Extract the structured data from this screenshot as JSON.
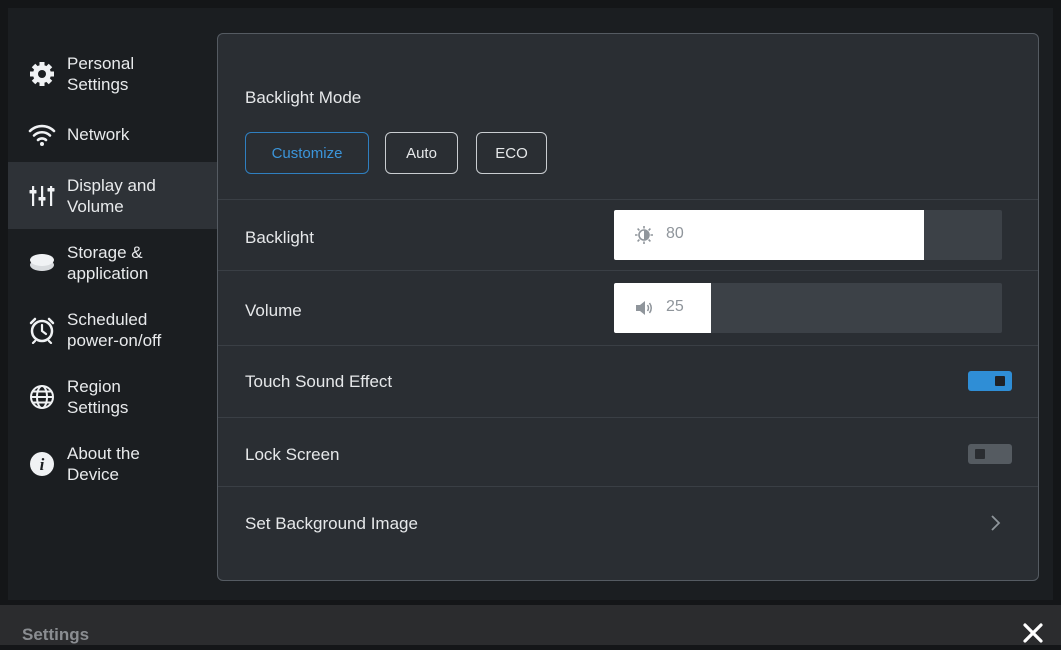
{
  "sidebar": {
    "items": [
      {
        "label_line1": "Personal",
        "label_line2": "Settings",
        "icon": "gear-icon"
      },
      {
        "label_line1": "Network",
        "icon": "wifi-icon"
      },
      {
        "label_line1": "Display and",
        "label_line2": "Volume",
        "icon": "sliders-icon",
        "active": true
      },
      {
        "label_line1": "Storage &",
        "label_line2": "application",
        "icon": "storage-icon"
      },
      {
        "label_line1": "Scheduled",
        "label_line2": "power-on/off",
        "icon": "alarm-clock-icon"
      },
      {
        "label_line1": "Region",
        "label_line2": "Settings",
        "icon": "globe-icon"
      },
      {
        "label_line1": "About the",
        "label_line2": "Device",
        "icon": "info-icon"
      }
    ]
  },
  "panel": {
    "backlight_mode": {
      "title": "Backlight Mode",
      "options": [
        "Customize",
        "Auto",
        "ECO"
      ],
      "selected": "Customize"
    },
    "backlight": {
      "label": "Backlight",
      "value": "80",
      "level": 0.8,
      "icon": "brightness-icon"
    },
    "volume": {
      "label": "Volume",
      "value": "25",
      "level": 0.25,
      "icon": "speaker-icon"
    },
    "touch_sound": {
      "label": "Touch Sound Effect",
      "enabled": true
    },
    "lock_screen": {
      "label": "Lock Screen",
      "enabled": false
    },
    "background_image": {
      "label": "Set Background Image",
      "icon": "chevron-right-icon"
    }
  },
  "bottom_bar": {
    "title": "Settings",
    "close_icon": "close-icon"
  },
  "colors": {
    "accent": "#2f8ed6",
    "panel_bg": "#2a2e33",
    "sidebar_active_bg": "#2e3237"
  }
}
